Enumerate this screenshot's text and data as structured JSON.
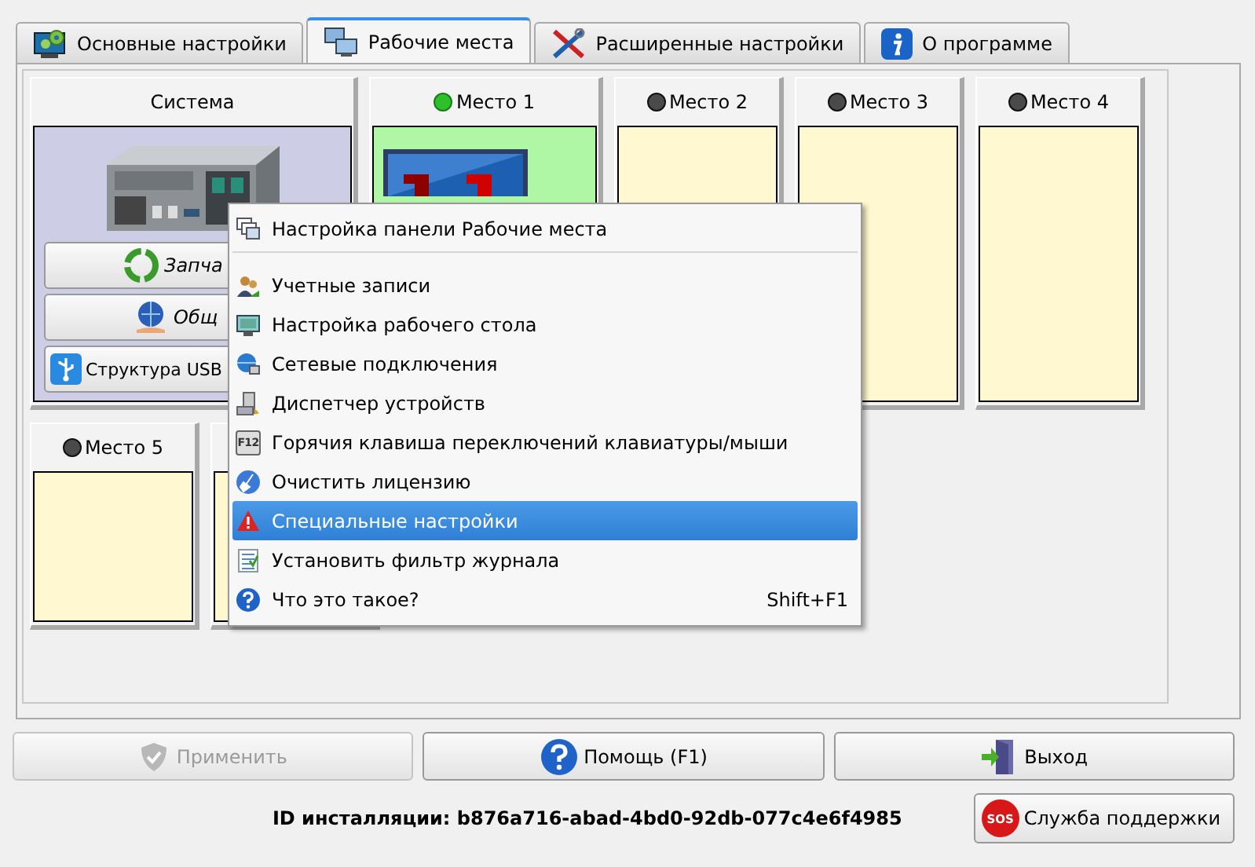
{
  "tabs": [
    {
      "label": "Основные настройки",
      "selected": false
    },
    {
      "label": "Рабочие места",
      "selected": true
    },
    {
      "label": "Расширенные настройки",
      "selected": false
    },
    {
      "label": "О программе",
      "selected": false
    }
  ],
  "system_card": {
    "title": "Система",
    "buttons": [
      {
        "label": "Запча",
        "kind": "italic"
      },
      {
        "label": "Общ",
        "kind": "italic"
      },
      {
        "label": "Структура USB",
        "kind": "plain"
      }
    ]
  },
  "places": [
    {
      "name": "Место 1",
      "online": true
    },
    {
      "name": "Место 2",
      "online": false
    },
    {
      "name": "Место 3",
      "online": false
    },
    {
      "name": "Место 4",
      "online": false
    },
    {
      "name": "Место 5",
      "online": false
    },
    {
      "kind": "covered"
    }
  ],
  "context_menu": [
    {
      "label": "Настройка панели Рабочие места",
      "selected": false,
      "separator_after": true
    },
    {
      "label": "Учетные записи",
      "selected": false,
      "separator_after": false
    },
    {
      "label": "Настройка рабочего стола",
      "selected": false,
      "separator_after": false
    },
    {
      "label": "Сетевые подключения",
      "selected": false,
      "separator_after": false
    },
    {
      "label": "Диспетчер устройств",
      "selected": false,
      "separator_after": false
    },
    {
      "label": "Горячия клавиша переключений клавиатуры/мыши",
      "icon_text": "F12",
      "selected": false,
      "separator_after": false
    },
    {
      "label": "Очистить лицензию",
      "selected": false,
      "separator_after": false
    },
    {
      "label": "Специальные настройки",
      "selected": true,
      "separator_after": false
    },
    {
      "label": "Установить фильтр журнала",
      "selected": false,
      "separator_after": false
    },
    {
      "label": "Что это такое?",
      "shortcut": "Shift+F1",
      "selected": false,
      "separator_after": false
    }
  ],
  "footer_buttons": [
    {
      "label": "Применить",
      "disabled": true
    },
    {
      "label": "Помощь (F1)",
      "disabled": false
    },
    {
      "label": "Выход",
      "disabled": false
    }
  ],
  "install_id": "ID инсталляции: b876a716-abad-4bd0-92db-077c4e6f4985",
  "support_button": {
    "label": "Служба поддержки",
    "icon_text": "SOS"
  }
}
